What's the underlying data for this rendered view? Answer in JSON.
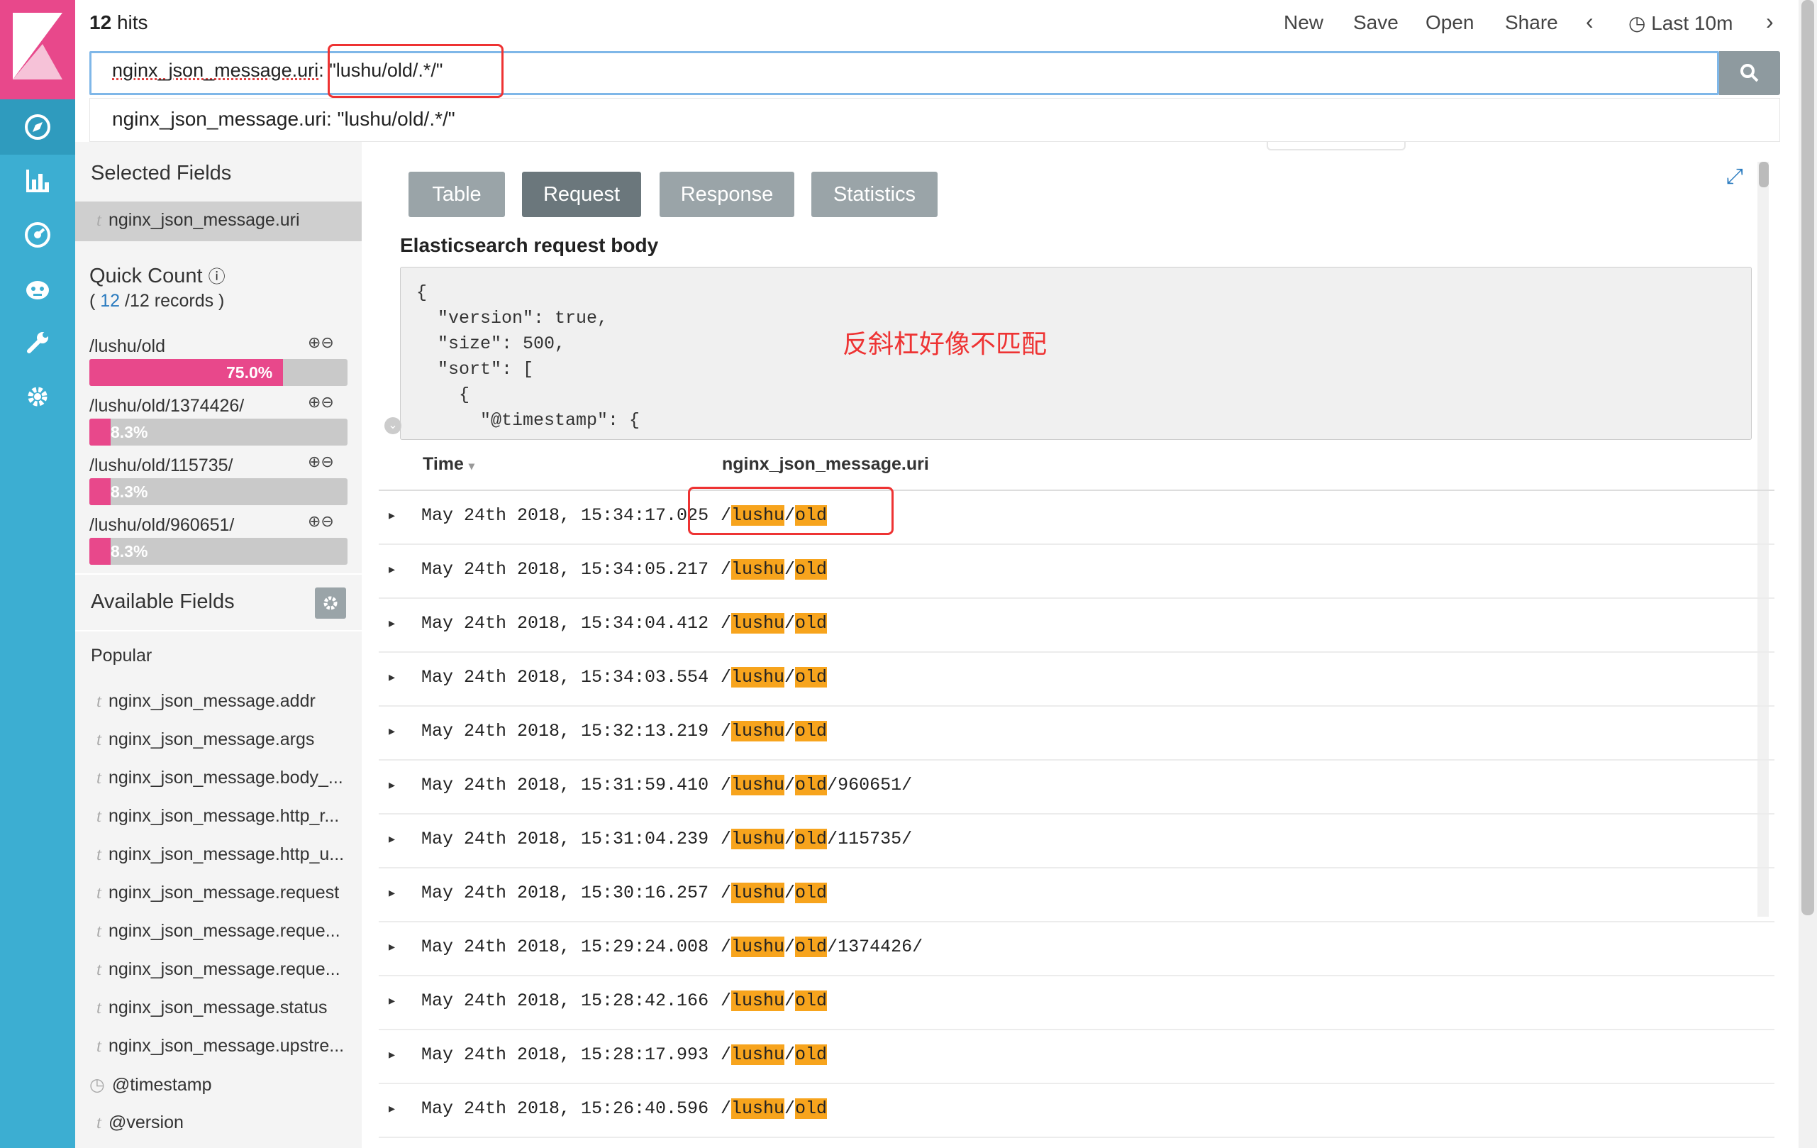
{
  "header": {
    "hits_count": "12",
    "hits_label": "hits",
    "menu": [
      "New",
      "Save",
      "Open",
      "Share"
    ],
    "time_range": "Last 10m"
  },
  "query": {
    "field_part": "nginx_json_message.uri",
    "value_part": ": \"lushu/old/.*/\""
  },
  "suggestion": "nginx_json_message.uri: \"lushu/old/.*/\"",
  "sidebar": {
    "selected_title": "Selected Fields",
    "selected_fields": [
      "nginx_json_message.uri"
    ],
    "quick_count_title": "Quick Count",
    "quick_count_open": "(",
    "quick_count_n": "12",
    "quick_count_rest": "/12 records )",
    "quick_values": [
      {
        "label": "/lushu/old",
        "pct_text": "75.0%",
        "pct": 75.0
      },
      {
        "label": "/lushu/old/1374426/",
        "pct_text": "8.3%",
        "pct": 8.3
      },
      {
        "label": "/lushu/old/115735/",
        "pct_text": "8.3%",
        "pct": 8.3
      },
      {
        "label": "/lushu/old/960651/",
        "pct_text": "8.3%",
        "pct": 8.3
      }
    ],
    "available_title": "Available Fields",
    "popular_title": "Popular",
    "popular_fields": [
      "nginx_json_message.addr",
      "nginx_json_message.args",
      "nginx_json_message.body_...",
      "nginx_json_message.http_r...",
      "nginx_json_message.http_u...",
      "nginx_json_message.request",
      "nginx_json_message.reque...",
      "nginx_json_message.reque...",
      "nginx_json_message.status",
      "nginx_json_message.upstre..."
    ],
    "other_fields": [
      "@timestamp",
      "@version"
    ]
  },
  "inspector": {
    "tabs": [
      "Table",
      "Request",
      "Response",
      "Statistics"
    ],
    "active_tab": "Request",
    "section_title": "Elasticsearch request body",
    "code": "{\n  \"version\": true,\n  \"size\": 500,\n  \"sort\": [\n    {\n      \"@timestamp\": {"
  },
  "annotation": "反斜杠好像不匹配",
  "table": {
    "columns": [
      "Time",
      "nginx_json_message.uri"
    ],
    "rows": [
      {
        "time": "May 24th 2018, 15:34:17.025",
        "suffix": ""
      },
      {
        "time": "May 24th 2018, 15:34:05.217",
        "suffix": ""
      },
      {
        "time": "May 24th 2018, 15:34:04.412",
        "suffix": ""
      },
      {
        "time": "May 24th 2018, 15:34:03.554",
        "suffix": ""
      },
      {
        "time": "May 24th 2018, 15:32:13.219",
        "suffix": ""
      },
      {
        "time": "May 24th 2018, 15:31:59.410",
        "suffix": "/960651/"
      },
      {
        "time": "May 24th 2018, 15:31:04.239",
        "suffix": "/115735/"
      },
      {
        "time": "May 24th 2018, 15:30:16.257",
        "suffix": ""
      },
      {
        "time": "May 24th 2018, 15:29:24.008",
        "suffix": "/1374426/"
      },
      {
        "time": "May 24th 2018, 15:28:42.166",
        "suffix": ""
      },
      {
        "time": "May 24th 2018, 15:28:17.993",
        "suffix": ""
      },
      {
        "time": "May 24th 2018, 15:26:40.596",
        "suffix": ""
      }
    ],
    "uri_prefix": "/",
    "hl1": "lushu",
    "sep": "/",
    "hl2": "old"
  },
  "colors": {
    "nav": "#3caed2",
    "logo": "#e8488b",
    "highlight": "#f7a41d",
    "annotation": "#e33333"
  }
}
